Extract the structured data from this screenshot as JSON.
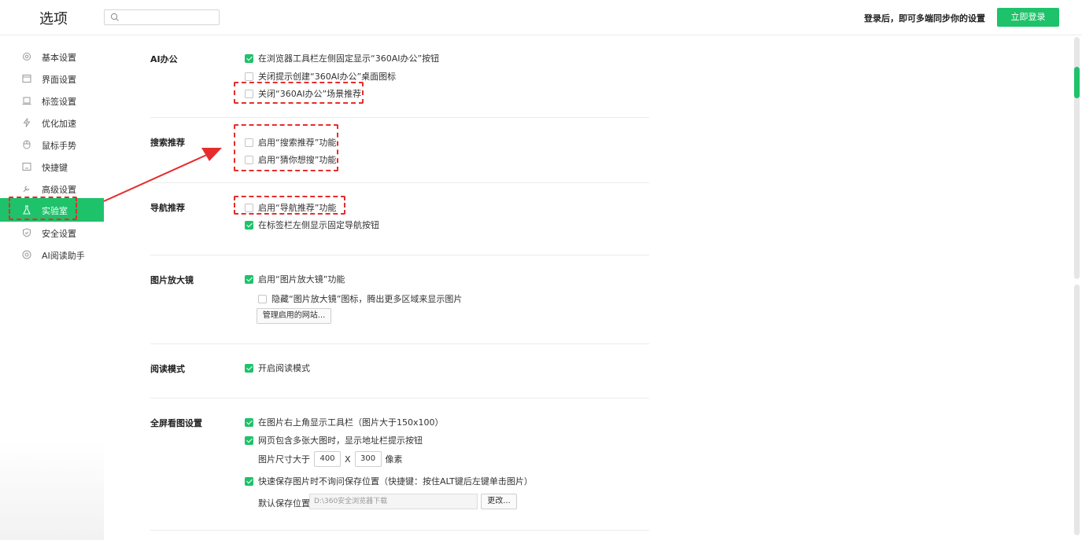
{
  "header": {
    "title": "选项",
    "search_placeholder": "",
    "login_prompt": "登录后，即可多端同步你的设置",
    "login_button": "立即登录"
  },
  "sidebar": {
    "items": [
      {
        "label": "基本设置",
        "icon": "gear-icon"
      },
      {
        "label": "界面设置",
        "icon": "window-icon"
      },
      {
        "label": "标签设置",
        "icon": "tab-icon"
      },
      {
        "label": "优化加速",
        "icon": "lightning-icon"
      },
      {
        "label": "鼠标手势",
        "icon": "mouse-icon"
      },
      {
        "label": "快捷键",
        "icon": "keyboard-icon"
      },
      {
        "label": "高级设置",
        "icon": "wrench-icon"
      },
      {
        "label": "实验室",
        "icon": "flask-icon",
        "active": true
      },
      {
        "label": "安全设置",
        "icon": "shield-icon"
      },
      {
        "label": "AI阅读助手",
        "icon": "ai-icon"
      }
    ]
  },
  "sections": {
    "ai": {
      "title": "AI办公",
      "opt1": "在浏览器工具栏左侧固定显示“360AI办公”按钮",
      "opt2": "关闭提示创建“360AI办公”桌面图标",
      "opt3": "关闭“360AI办公”场景推荐"
    },
    "search": {
      "title": "搜索推荐",
      "opt1": "启用“搜索推荐”功能",
      "opt2": "启用“猜你想搜”功能"
    },
    "nav": {
      "title": "导航推荐",
      "opt1": "启用“导航推荐”功能",
      "opt2": "在标签栏左侧显示固定导航按钮"
    },
    "magnifier": {
      "title": "图片放大镜",
      "opt1": "启用“图片放大镜”功能",
      "opt2": "隐藏“图片放大镜”图标，腾出更多区域来显示图片",
      "manage_button": "管理启用的网站..."
    },
    "reading": {
      "title": "阅读模式",
      "opt1": "开启阅读模式"
    },
    "fullscreen": {
      "title": "全屏看图设置",
      "opt1": "在图片右上角显示工具栏（图片大于150x100）",
      "opt2": "网页包含多张大图时，显示地址栏提示按钮",
      "size_label": "图片尺寸大于",
      "width_value": "400",
      "x_label": "X",
      "height_value": "300",
      "unit_label": "像素",
      "opt3": "快速保存图片时不询问保存位置（快捷键：按住ALT键后左键单击图片）",
      "save_label": "默认保存位置：",
      "save_path": "D:\\360安全浏览器下载",
      "change_button": "更改..."
    }
  },
  "colors": {
    "accent": "#1ec26a",
    "annotation": "#e52d2d"
  }
}
